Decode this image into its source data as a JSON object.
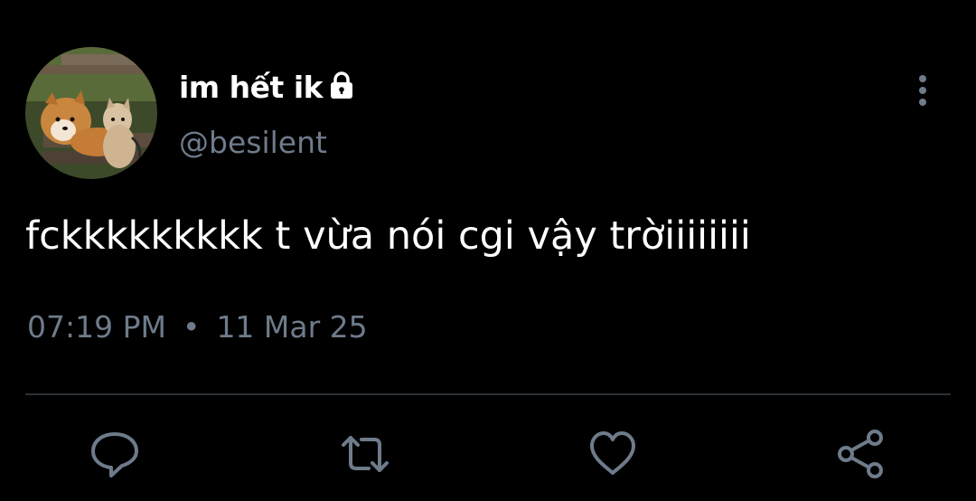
{
  "user": {
    "display_name": "im hết ik",
    "handle": "@besilent",
    "protected": true,
    "avatar_description_icon": "avatar"
  },
  "tweet": {
    "text": "fckkkkkkkkk t vừa nói cgi vậy trờiiiiiiii",
    "time": "07:19 PM",
    "separator": "•",
    "date": "11 Mar 25"
  },
  "actions": [
    {
      "icon": "reply-icon"
    },
    {
      "icon": "retweet-icon"
    },
    {
      "icon": "like-icon"
    },
    {
      "icon": "share-icon"
    }
  ],
  "colors": {
    "background": "#000000",
    "text": "#ffffff",
    "muted": "#6e7b8a",
    "divider": "#2b3035"
  }
}
